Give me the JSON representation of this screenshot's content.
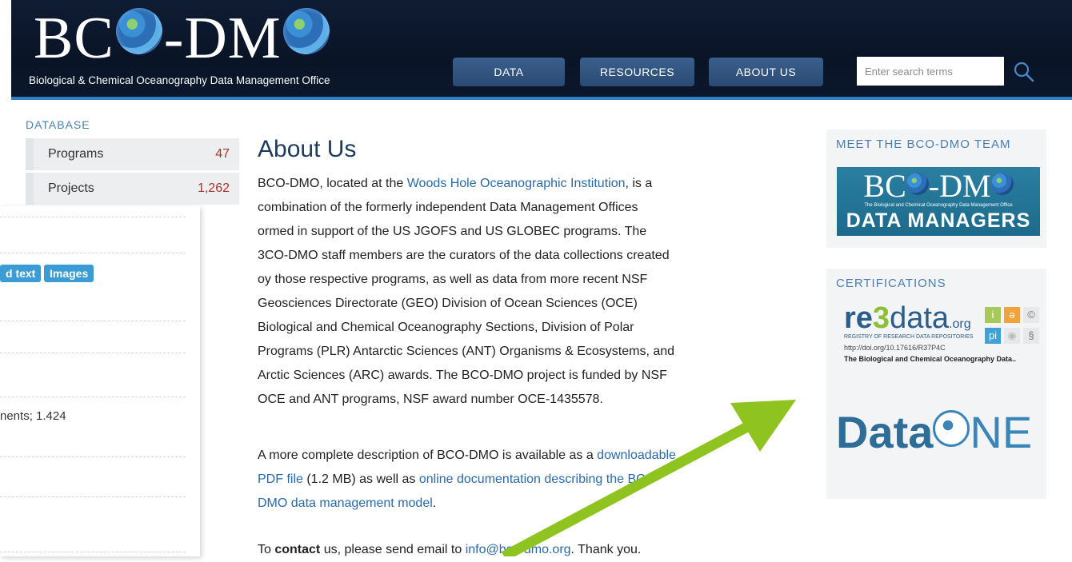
{
  "header": {
    "logo_text_left": "BC",
    "logo_text_mid": "-DM",
    "tagline": "Biological & Chemical Oceanography Data Management Office",
    "nav": [
      "DATA",
      "RESOURCES",
      "ABOUT US"
    ],
    "search_placeholder": "Enter search terms"
  },
  "sidebar": {
    "section_label": "DATABASE",
    "items": [
      {
        "label": "Programs",
        "count": "47"
      },
      {
        "label": "Projects",
        "count": "1,262"
      }
    ]
  },
  "overlay": {
    "tags": [
      "d text",
      "Images"
    ],
    "fragment": "nents; 1.424"
  },
  "main": {
    "title": "About Us",
    "p1_start": "BCO-DMO, located at the ",
    "p1_link": "Woods Hole Oceanographic Institution",
    "p1_lines": [
      ", is a",
      "combination of the formerly independent Data Management Offices",
      "ormed in support of the US JGOFS and US GLOBEC programs. The",
      "3CO-DMO staff members are the curators of the data collections created",
      "oy those respective programs, as well as data from more recent NSF",
      "Geosciences Directorate (GEO) Division of Ocean Sciences (OCE)",
      "Biological and Chemical Oceanography Sections, Division of Polar",
      "Programs (PLR) Antarctic Sciences (ANT) Organisms & Ecosystems, and",
      "Arctic Sciences (ARC) awards.  The BCO-DMO project is funded by NSF",
      "OCE and ANT programs, NSF award number OCE-1435578."
    ],
    "p2_a": "A more complete description of BCO-DMO is available as a ",
    "p2_link1": "downloadable",
    "p2_link1b": "PDF file",
    "p2_b": " (1.2 MB) as well as ",
    "p2_link2": "online documentation describing the BCO-",
    "p2_link2b": "DMO data management model",
    "p2_end": ".",
    "p3_a": "To ",
    "p3_bold": "contact",
    "p3_b": " us, please send email to ",
    "p3_link": "info@bco-dmo.org",
    "p3_end": ". Thank you."
  },
  "right": {
    "team_heading": "MEET THE BCO-DMO TEAM",
    "team_badge_top_left": "BC",
    "team_badge_top_mid": "-DM",
    "team_badge_sub": "The Biological and Chemical Oceanography Data Management Office",
    "team_badge_main": "DATA MANAGERS",
    "cert_heading": "CERTIFICATIONS",
    "re3_re": "re",
    "re3_3": "3",
    "re3_data": "data",
    "re3_org": ".org",
    "re3_sub": "REGISTRY OF RESEARCH DATA REPOSITORIES",
    "re3_doi": "http://doi.org/10.17616/R37P4C",
    "re3_name": "The Biological and Chemical Oceanography Data..",
    "re3_icons": [
      "i",
      "ə",
      "©",
      "pi",
      "◉",
      "§"
    ],
    "dataone_a": "Data",
    "dataone_b": "NE"
  },
  "colors": {
    "arrow": "#8fc31f",
    "header_bg": "#0b172c",
    "accent": "#2a6aa8"
  }
}
